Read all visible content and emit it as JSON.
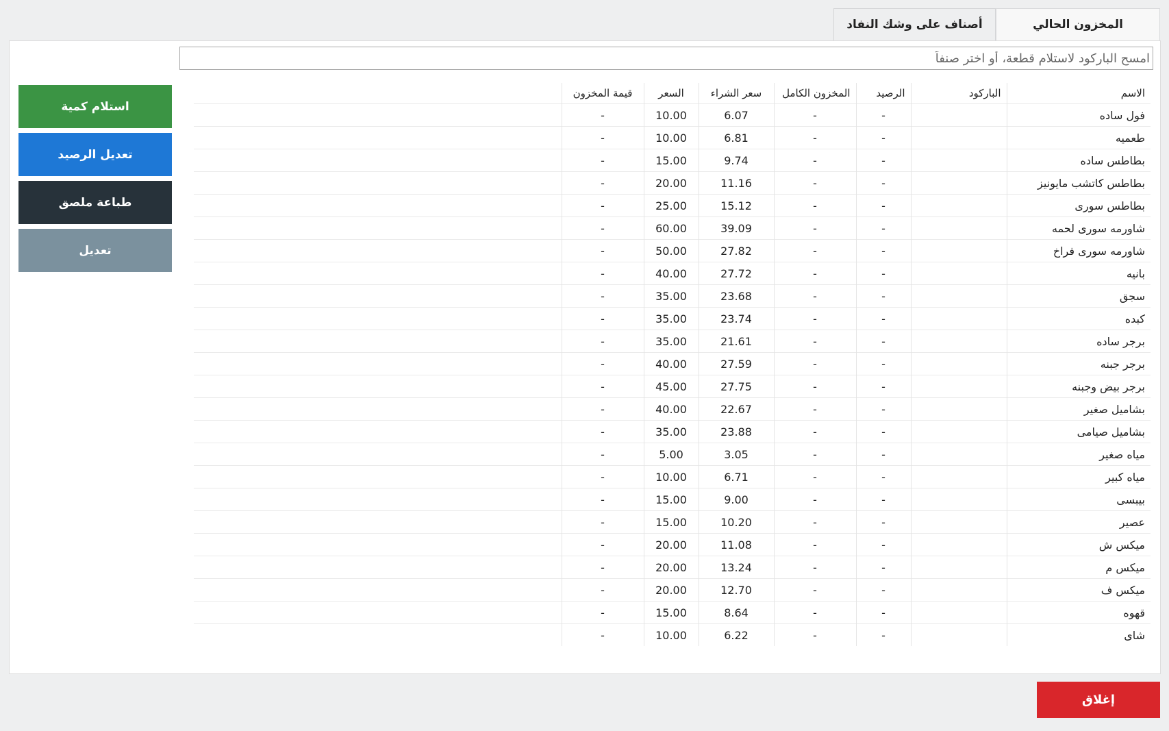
{
  "tabs": [
    {
      "label": "المخزون الحالي",
      "active": true
    },
    {
      "label": "أصناف على وشك النفاد",
      "active": false
    }
  ],
  "search": {
    "placeholder": "امسح الباركود لاستلام قطعة، أو اختر صنفاً"
  },
  "actions": [
    {
      "label": "استلام كمية",
      "color": "#3b9444"
    },
    {
      "label": "تعديل الرصيد",
      "color": "#1e78d6"
    },
    {
      "label": "طباعة ملصق",
      "color": "#27323a"
    },
    {
      "label": "تعديل",
      "color": "#7b919e"
    }
  ],
  "table": {
    "headers": [
      "الاسم",
      "الباركود",
      "الرصيد",
      "المخزون الكامل",
      "سعر الشراء",
      "السعر",
      "قيمة المخزون"
    ],
    "rows": [
      {
        "name": "فول ساده",
        "barcode": "",
        "balance": "-",
        "full_stock": "-",
        "purchase_price": "6.07",
        "price": "10.00",
        "stock_value": "-"
      },
      {
        "name": "طعميه",
        "barcode": "",
        "balance": "-",
        "full_stock": "-",
        "purchase_price": "6.81",
        "price": "10.00",
        "stock_value": "-"
      },
      {
        "name": "بطاطس ساده",
        "barcode": "",
        "balance": "-",
        "full_stock": "-",
        "purchase_price": "9.74",
        "price": "15.00",
        "stock_value": "-"
      },
      {
        "name": "بطاطس كاتشب مايونيز",
        "barcode": "",
        "balance": "-",
        "full_stock": "-",
        "purchase_price": "11.16",
        "price": "20.00",
        "stock_value": "-"
      },
      {
        "name": "بطاطس سورى",
        "barcode": "",
        "balance": "-",
        "full_stock": "-",
        "purchase_price": "15.12",
        "price": "25.00",
        "stock_value": "-"
      },
      {
        "name": "شاورمه سورى لحمه",
        "barcode": "",
        "balance": "-",
        "full_stock": "-",
        "purchase_price": "39.09",
        "price": "60.00",
        "stock_value": "-"
      },
      {
        "name": "شاورمه سورى فراخ",
        "barcode": "",
        "balance": "-",
        "full_stock": "-",
        "purchase_price": "27.82",
        "price": "50.00",
        "stock_value": "-"
      },
      {
        "name": "بانيه",
        "barcode": "",
        "balance": "-",
        "full_stock": "-",
        "purchase_price": "27.72",
        "price": "40.00",
        "stock_value": "-"
      },
      {
        "name": "سجق",
        "barcode": "",
        "balance": "-",
        "full_stock": "-",
        "purchase_price": "23.68",
        "price": "35.00",
        "stock_value": "-"
      },
      {
        "name": "كبده",
        "barcode": "",
        "balance": "-",
        "full_stock": "-",
        "purchase_price": "23.74",
        "price": "35.00",
        "stock_value": "-"
      },
      {
        "name": "برجر ساده",
        "barcode": "",
        "balance": "-",
        "full_stock": "-",
        "purchase_price": "21.61",
        "price": "35.00",
        "stock_value": "-"
      },
      {
        "name": "برجر جبنه",
        "barcode": "",
        "balance": "-",
        "full_stock": "-",
        "purchase_price": "27.59",
        "price": "40.00",
        "stock_value": "-"
      },
      {
        "name": "برجر بيض وجبنه",
        "barcode": "",
        "balance": "-",
        "full_stock": "-",
        "purchase_price": "27.75",
        "price": "45.00",
        "stock_value": "-"
      },
      {
        "name": "بشاميل صغير",
        "barcode": "",
        "balance": "-",
        "full_stock": "-",
        "purchase_price": "22.67",
        "price": "40.00",
        "stock_value": "-"
      },
      {
        "name": "بشاميل صيامى",
        "barcode": "",
        "balance": "-",
        "full_stock": "-",
        "purchase_price": "23.88",
        "price": "35.00",
        "stock_value": "-"
      },
      {
        "name": "مياه صغير",
        "barcode": "",
        "balance": "-",
        "full_stock": "-",
        "purchase_price": "3.05",
        "price": "5.00",
        "stock_value": "-"
      },
      {
        "name": "مياه كبير",
        "barcode": "",
        "balance": "-",
        "full_stock": "-",
        "purchase_price": "6.71",
        "price": "10.00",
        "stock_value": "-"
      },
      {
        "name": "بيبسى",
        "barcode": "",
        "balance": "-",
        "full_stock": "-",
        "purchase_price": "9.00",
        "price": "15.00",
        "stock_value": "-"
      },
      {
        "name": "عصير",
        "barcode": "",
        "balance": "-",
        "full_stock": "-",
        "purchase_price": "10.20",
        "price": "15.00",
        "stock_value": "-"
      },
      {
        "name": "ميكس ش",
        "barcode": "",
        "balance": "-",
        "full_stock": "-",
        "purchase_price": "11.08",
        "price": "20.00",
        "stock_value": "-"
      },
      {
        "name": "ميكس م",
        "barcode": "",
        "balance": "-",
        "full_stock": "-",
        "purchase_price": "13.24",
        "price": "20.00",
        "stock_value": "-"
      },
      {
        "name": "ميكس ف",
        "barcode": "",
        "balance": "-",
        "full_stock": "-",
        "purchase_price": "12.70",
        "price": "20.00",
        "stock_value": "-"
      },
      {
        "name": "قهوه",
        "barcode": "",
        "balance": "-",
        "full_stock": "-",
        "purchase_price": "8.64",
        "price": "15.00",
        "stock_value": "-"
      },
      {
        "name": "شاى",
        "barcode": "",
        "balance": "-",
        "full_stock": "-",
        "purchase_price": "6.22",
        "price": "10.00",
        "stock_value": "-"
      }
    ]
  },
  "close_button": {
    "label": "إغلاق",
    "color": "#d9262b"
  }
}
